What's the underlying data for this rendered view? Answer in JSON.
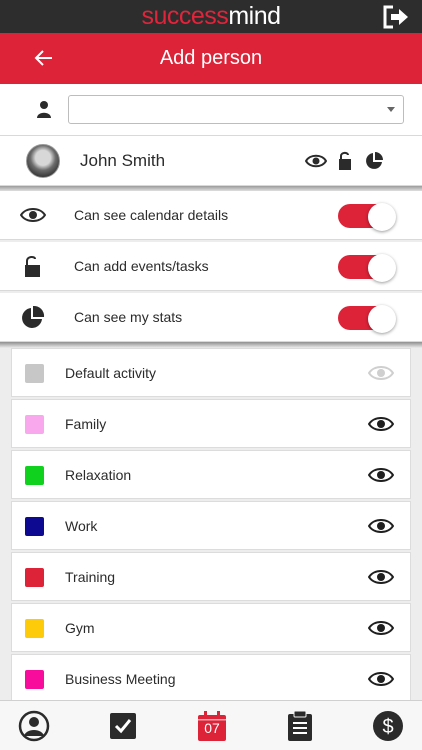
{
  "app": {
    "brand_part1": "success",
    "brand_part2": "mind",
    "logout_icon": "logout-icon",
    "brand_color": "#dc2338"
  },
  "header": {
    "title": "Add person",
    "back_icon": "arrow-left-icon"
  },
  "person_select": {
    "icon": "person-icon",
    "value": "",
    "placeholder": ""
  },
  "person": {
    "name": "John Smith",
    "icons": [
      "eye-icon",
      "unlock-icon",
      "pie-chart-icon"
    ]
  },
  "permissions": [
    {
      "icon": "eye-icon",
      "label": "Can see calendar details",
      "enabled": true
    },
    {
      "icon": "unlock-icon",
      "label": "Can add events/tasks",
      "enabled": true
    },
    {
      "icon": "pie-chart-icon",
      "label": "Can see my stats",
      "enabled": true
    }
  ],
  "activities": [
    {
      "label": "Default activity",
      "color": "#c7c7c7",
      "visible": false
    },
    {
      "label": "Family",
      "color": "#f9a8ee",
      "visible": true
    },
    {
      "label": "Relaxation",
      "color": "#11d11f",
      "visible": true
    },
    {
      "label": "Work",
      "color": "#0d0991",
      "visible": true
    },
    {
      "label": "Training",
      "color": "#dc2338",
      "visible": true
    },
    {
      "label": "Gym",
      "color": "#fdcb0a",
      "visible": true
    },
    {
      "label": "Business Meeting",
      "color": "#f80c9c",
      "visible": true
    }
  ],
  "bottom_nav": {
    "tabs": [
      "profile-icon",
      "checkbox-icon",
      "calendar-icon",
      "clipboard-icon",
      "dollar-icon"
    ],
    "calendar_date": "07",
    "active_tab": "calendar-icon"
  }
}
